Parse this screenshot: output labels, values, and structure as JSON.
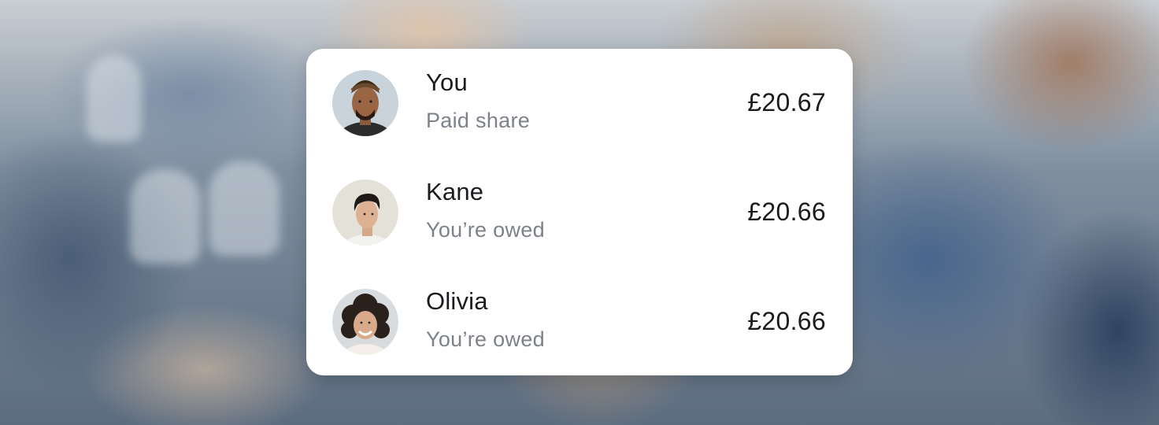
{
  "rows": [
    {
      "name": "You",
      "status": "Paid share",
      "amount": "£20.67",
      "avatar_icon": "person-avatar-icon"
    },
    {
      "name": "Kane",
      "status": "You’re owed",
      "amount": "£20.66",
      "avatar_icon": "person-avatar-icon"
    },
    {
      "name": "Olivia",
      "status": "You’re owed",
      "amount": "£20.66",
      "avatar_icon": "person-avatar-icon"
    }
  ],
  "colors": {
    "card": "#ffffff",
    "text_primary": "#1b1b1f",
    "text_secondary": "#7d8189"
  }
}
